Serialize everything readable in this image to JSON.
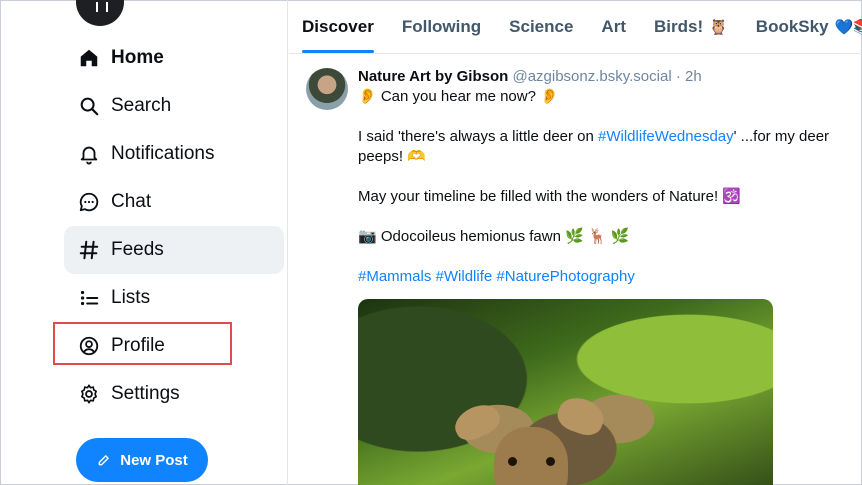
{
  "sidebar": {
    "items": [
      {
        "label": "Home",
        "icon": "home-icon"
      },
      {
        "label": "Search",
        "icon": "search-icon"
      },
      {
        "label": "Notifications",
        "icon": "bell-icon"
      },
      {
        "label": "Chat",
        "icon": "chat-icon"
      },
      {
        "label": "Feeds",
        "icon": "hash-icon"
      },
      {
        "label": "Lists",
        "icon": "list-icon"
      },
      {
        "label": "Profile",
        "icon": "user-circle-icon"
      },
      {
        "label": "Settings",
        "icon": "gear-icon"
      }
    ],
    "new_post_label": "New Post"
  },
  "tabs": [
    {
      "label": "Discover",
      "emoji": ""
    },
    {
      "label": "Following",
      "emoji": ""
    },
    {
      "label": "Science",
      "emoji": ""
    },
    {
      "label": "Art",
      "emoji": ""
    },
    {
      "label": "Birds!",
      "emoji": "🦉"
    },
    {
      "label": "BookSky",
      "emoji": "💙📚"
    }
  ],
  "post": {
    "author": "Nature Art by Gibson",
    "handle": "@azgibsonz.bsky.social",
    "time": "· 2h",
    "line1": "👂 Can you hear me now? 👂",
    "line2_pre": "I said 'there's always a little deer on ",
    "line2_link": "#WildlifeWednesday",
    "line2_post": "' ...for my deer",
    "line3": "peeps! 🫶",
    "line4": "May your timeline be filled with the wonders of Nature! 🕉️",
    "line5": "📷 Odocoileus hemionus fawn 🌿 🦌 🌿",
    "hashtags": [
      "#Mammals",
      "#Wildlife",
      "#NaturePhotography"
    ]
  },
  "colors": {
    "accent": "#1083fe",
    "highlight": "#e04b4b"
  }
}
